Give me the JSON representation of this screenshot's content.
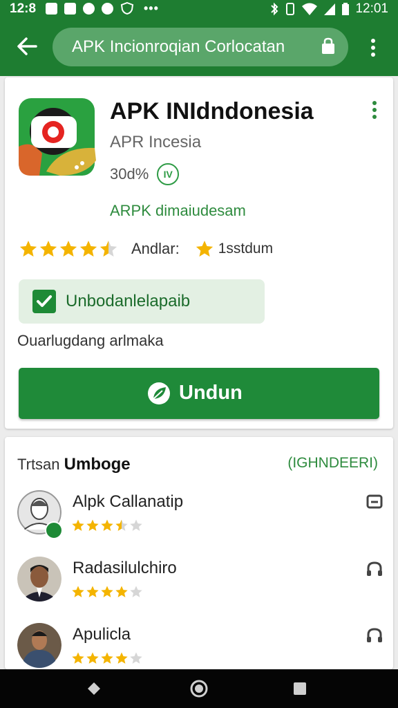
{
  "status_bar": {
    "time": "12:8",
    "clock": "12:01",
    "more": "•••"
  },
  "toolbar": {
    "search_text": "APK Incionroqian Corlocatan"
  },
  "app": {
    "title": "APK INIdndonesia",
    "developer": "APR Incesia",
    "size": "30d%",
    "badge": "IV",
    "link_text": "ARPK dimaiudesam",
    "rating": 4.5,
    "rating_label": "Andlar:",
    "downloads": "1sstdum",
    "verified_text": "Unbodanlelapaib",
    "note": "Ouarlugdang arlmaka",
    "download_label": "Undun"
  },
  "reviews": {
    "header_prefix": "Trtsan",
    "header_bold": "Umboge",
    "header_link": "(IGHNDEERI)",
    "items": [
      {
        "name": "Alpk Callanatip",
        "rating": 3.5
      },
      {
        "name": "Radasilulchiro",
        "rating": 4
      },
      {
        "name": "Apulicla",
        "rating": 4
      }
    ]
  },
  "colors": {
    "brand_green": "#1e7d31",
    "button_green": "#1f8a39",
    "star_gold": "#f4b400"
  }
}
